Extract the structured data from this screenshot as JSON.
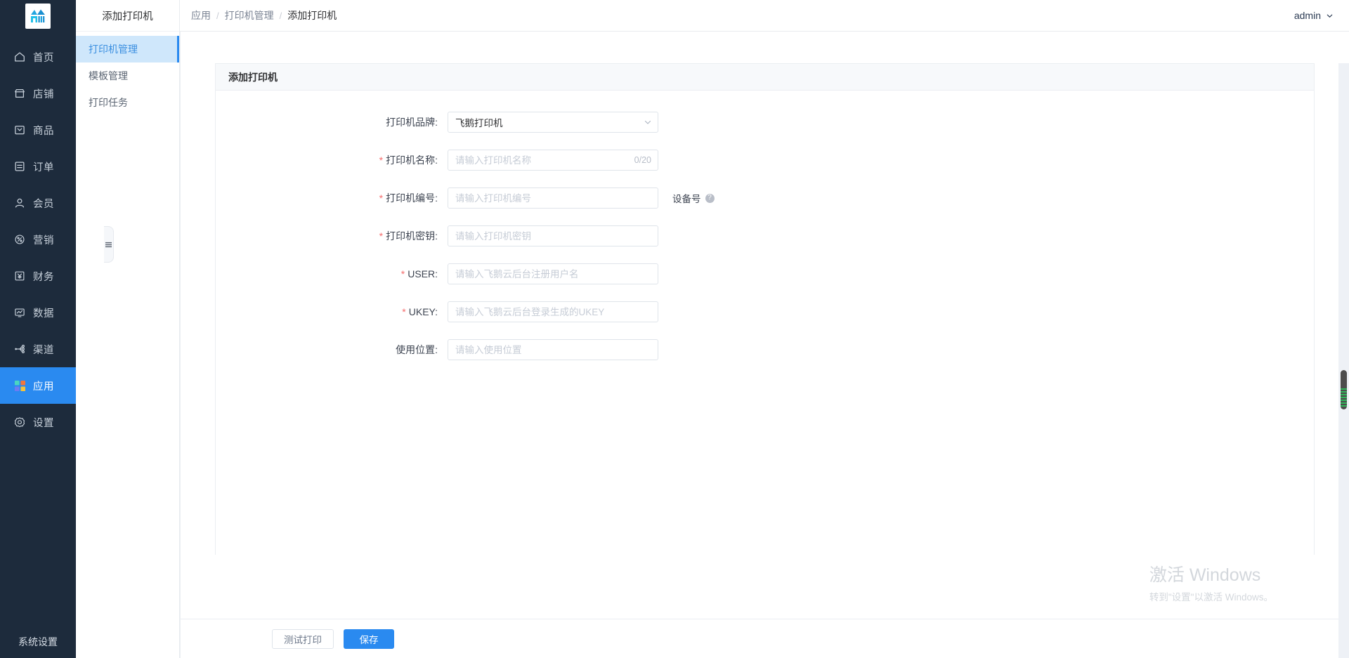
{
  "brand": {
    "logo_icon": "mountain-shop-logo",
    "accent": "#2a8af0",
    "rail_bg": "#1d2b3c"
  },
  "rail": {
    "items": [
      {
        "label": "首页",
        "icon": "home-icon",
        "active": false
      },
      {
        "label": "店铺",
        "icon": "store-icon",
        "active": false
      },
      {
        "label": "商品",
        "icon": "goods-icon",
        "active": false
      },
      {
        "label": "订单",
        "icon": "order-icon",
        "active": false
      },
      {
        "label": "会员",
        "icon": "member-icon",
        "active": false
      },
      {
        "label": "营销",
        "icon": "marketing-icon",
        "active": false
      },
      {
        "label": "财务",
        "icon": "finance-icon",
        "active": false
      },
      {
        "label": "数据",
        "icon": "data-icon",
        "active": false
      },
      {
        "label": "渠道",
        "icon": "channel-icon",
        "active": false
      },
      {
        "label": "应用",
        "icon": "apps-icon",
        "active": true
      },
      {
        "label": "设置",
        "icon": "settings-icon",
        "active": false
      }
    ],
    "footer_label": "系统设置"
  },
  "submenu": {
    "header_title": "添加打印机",
    "items": [
      {
        "label": "打印机管理",
        "active": true
      },
      {
        "label": "模板管理",
        "active": false
      },
      {
        "label": "打印任务",
        "active": false
      }
    ],
    "collapse_icon": "collapse-menu-icon"
  },
  "topbar": {
    "breadcrumb": [
      "应用",
      "打印机管理",
      "添加打印机"
    ],
    "separator": "/",
    "user": "admin",
    "user_caret_icon": "chevron-down-icon"
  },
  "panel": {
    "title": "添加打印机"
  },
  "form": {
    "fields": [
      {
        "label": "打印机品牌:",
        "required": false,
        "type": "select",
        "value": "飞鹅打印机",
        "placeholder": "",
        "options": [
          "飞鹅打印机"
        ],
        "name": "printer-brand"
      },
      {
        "label": "打印机名称:",
        "required": true,
        "type": "text-count",
        "value": "",
        "placeholder": "请输入打印机名称",
        "counter": "0/20",
        "name": "printer-name"
      },
      {
        "label": "打印机编号:",
        "required": true,
        "type": "text",
        "value": "",
        "placeholder": "请输入打印机编号",
        "side_note": "设备号",
        "side_help_icon": "question-mark-icon",
        "name": "printer-number"
      },
      {
        "label": "打印机密钥:",
        "required": true,
        "type": "text",
        "value": "",
        "placeholder": "请输入打印机密钥",
        "name": "printer-secret"
      },
      {
        "label": "USER:",
        "required": true,
        "type": "text",
        "value": "",
        "placeholder": "请输入飞鹅云后台注册用户名",
        "name": "printer-user"
      },
      {
        "label": "UKEY:",
        "required": true,
        "type": "text",
        "value": "",
        "placeholder": "请输入飞鹅云后台登录生成的UKEY",
        "name": "printer-ukey"
      },
      {
        "label": "使用位置:",
        "required": false,
        "type": "text",
        "value": "",
        "placeholder": "请输入使用位置",
        "name": "printer-location"
      }
    ]
  },
  "footer": {
    "test_print_label": "测试打印",
    "save_label": "保存"
  },
  "watermark": {
    "title": "激活 Windows",
    "subtitle": "转到\"设置\"以激活 Windows。"
  }
}
